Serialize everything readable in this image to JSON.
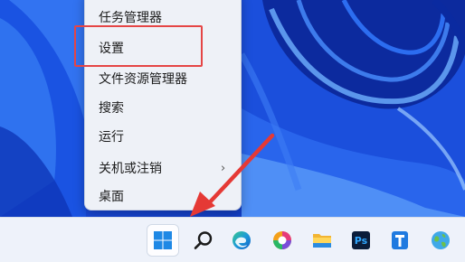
{
  "context_menu": {
    "items": [
      {
        "label": "任务管理器",
        "has_submenu": false
      },
      {
        "label": "设置",
        "has_submenu": false,
        "highlighted": true
      },
      {
        "label": "文件资源管理器",
        "has_submenu": false
      },
      {
        "label": "搜索",
        "has_submenu": false
      },
      {
        "label": "运行",
        "has_submenu": false
      },
      {
        "label": "关机或注销",
        "has_submenu": true,
        "submenu_glyph": "›"
      },
      {
        "label": "桌面",
        "has_submenu": false
      }
    ]
  },
  "taskbar": {
    "icons": [
      {
        "name": "windows-start-icon",
        "active": true
      },
      {
        "name": "search-icon"
      },
      {
        "name": "edge-browser-icon"
      },
      {
        "name": "color-app-icon"
      },
      {
        "name": "file-explorer-icon"
      },
      {
        "name": "photoshop-icon",
        "text": "Ps"
      },
      {
        "name": "pin-app-icon"
      },
      {
        "name": "earth-app-icon"
      }
    ]
  },
  "colors": {
    "highlight_border": "#e54545",
    "arrow": "#e53935",
    "menu_background": "#eef1f7",
    "taskbar_background": "#eef2fa",
    "wallpaper_base": "#1f56e0"
  }
}
